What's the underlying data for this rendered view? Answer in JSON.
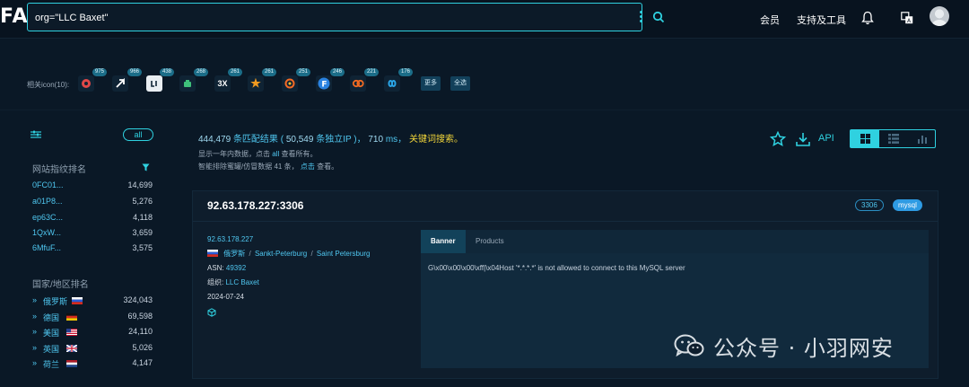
{
  "header": {
    "logo": "FA",
    "search_value": "org=\"LLC Baxet\"",
    "nav": [
      "会员",
      "支持及工具"
    ]
  },
  "icons": {
    "label": "相关icon(10):",
    "items": [
      {
        "count": "975",
        "name": "red-circle-icon",
        "color": "#e04848"
      },
      {
        "count": "966",
        "name": "white-arrow-icon",
        "color": "#ffffff"
      },
      {
        "count": "438",
        "name": "white-quote-icon",
        "color": "#ffffff"
      },
      {
        "count": "268",
        "name": "green-robot-icon",
        "color": "#3ec07a"
      },
      {
        "count": "261",
        "name": "3x-text-icon",
        "glyph": "3X"
      },
      {
        "count": "261",
        "name": "orange-star-icon",
        "color": "#f29a1f"
      },
      {
        "count": "251",
        "name": "grafana-icon",
        "color": "#f46a25"
      },
      {
        "count": "246",
        "name": "blue-f-icon",
        "color": "#2a82e0"
      },
      {
        "count": "221",
        "name": "orange-chain-icon",
        "color": "#f26b22"
      },
      {
        "count": "176",
        "name": "blue-infinity-icon",
        "color": "#2aa6e8"
      }
    ],
    "more_label": "更多",
    "all_label": "全选"
  },
  "left": {
    "all_label": "all",
    "site_rank_title": "网站指纹排名",
    "site_rank": [
      {
        "name": "0FC01...",
        "value": "14,699"
      },
      {
        "name": "a01P8...",
        "value": "5,276"
      },
      {
        "name": "ep63C...",
        "value": "4,118"
      },
      {
        "name": "1QxW...",
        "value": "3,659"
      },
      {
        "name": "6MfuF...",
        "value": "3,575"
      }
    ],
    "country_rank_title": "国家/地区排名",
    "country_rank": [
      {
        "name": "俄罗斯",
        "value": "324,043",
        "flag": "ru"
      },
      {
        "name": "德国",
        "value": "69,598",
        "flag": "de"
      },
      {
        "name": "美国",
        "value": "24,110",
        "flag": "us"
      },
      {
        "name": "英国",
        "value": "5,026",
        "flag": "gb"
      },
      {
        "name": "荷兰",
        "value": "4,147",
        "flag": "nl"
      }
    ]
  },
  "stats": {
    "results": "444,479",
    "results_label": "条匹配结果 (",
    "unique_ip": "50,549",
    "unique_label": "条独立IP )，",
    "ms": "710",
    "ms_label": "ms，",
    "keyword": "关键词搜索。",
    "line2_a": "显示一年内数据，点击",
    "line2_link": "all",
    "line2_b": "查看所有。",
    "line3_a": "智能排除蜜罐/仿冒数据",
    "line3_num": "41",
    "line3_b": "条，",
    "line3_link": "点击",
    "line3_c": "查看。"
  },
  "toolbar": {
    "api_label": "API"
  },
  "result": {
    "title": "92.63.178.227:3306",
    "port": "3306",
    "service": "mysql",
    "ip": "92.63.178.227",
    "country": "俄罗斯",
    "region": "Sankt-Peterburg",
    "city": "Saint Petersburg",
    "asn_label": "ASN:",
    "asn": "49392",
    "org_label": "组织:",
    "org": "LLC Baxet",
    "date": "2024-07-24",
    "tabs": [
      "Banner",
      "Products"
    ],
    "banner": "G\\x00\\x00\\x00\\xff|\\x04Host '*.*.*.*' is not allowed to connect to this MySQL server"
  },
  "watermark": {
    "text": "公众号 · 小羽网安"
  }
}
